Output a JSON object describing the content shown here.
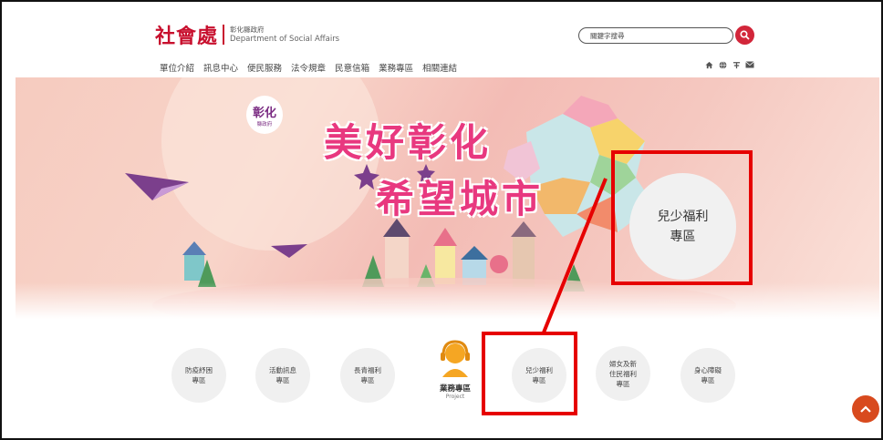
{
  "header": {
    "logo_main": "社會處",
    "logo_gov": "彰化縣政府",
    "logo_en": "Department of Social Affairs",
    "search_placeholder": "關鍵字搜尋"
  },
  "nav": {
    "items": [
      {
        "label": "單位介紹"
      },
      {
        "label": "訊息中心"
      },
      {
        "label": "便民服務"
      },
      {
        "label": "法令規章"
      },
      {
        "label": "民意信箱"
      },
      {
        "label": "業務專區"
      },
      {
        "label": "相關連結"
      }
    ],
    "icons": [
      "home-icon",
      "globe-icon",
      "fontsize-icon",
      "mail-icon"
    ]
  },
  "banner": {
    "line1": "美好彰化",
    "line2": "希望城市",
    "county_logo": "彰化",
    "county_logo_sub": "縣政府"
  },
  "callout": {
    "line1": "兒少福利",
    "line2": "專區"
  },
  "categories": [
    {
      "line1": "防疫紓困",
      "line2": "專區"
    },
    {
      "line1": "活動訊息",
      "line2": "專區"
    },
    {
      "line1": "長青福利",
      "line2": "專區"
    },
    {
      "line1": "兒少福利",
      "line2": "專區"
    },
    {
      "line1": "婦女及新",
      "line2": "住民福利",
      "line3": "專區"
    },
    {
      "line1": "身心障礙",
      "line2": "專區"
    }
  ],
  "project": {
    "title": "業務專區",
    "subtitle": "Project"
  },
  "colors": {
    "brand_red": "#c8102e",
    "highlight_red": "#e60000",
    "banner_pink": "#e8387f",
    "to_top_orange": "#d84a1e"
  }
}
